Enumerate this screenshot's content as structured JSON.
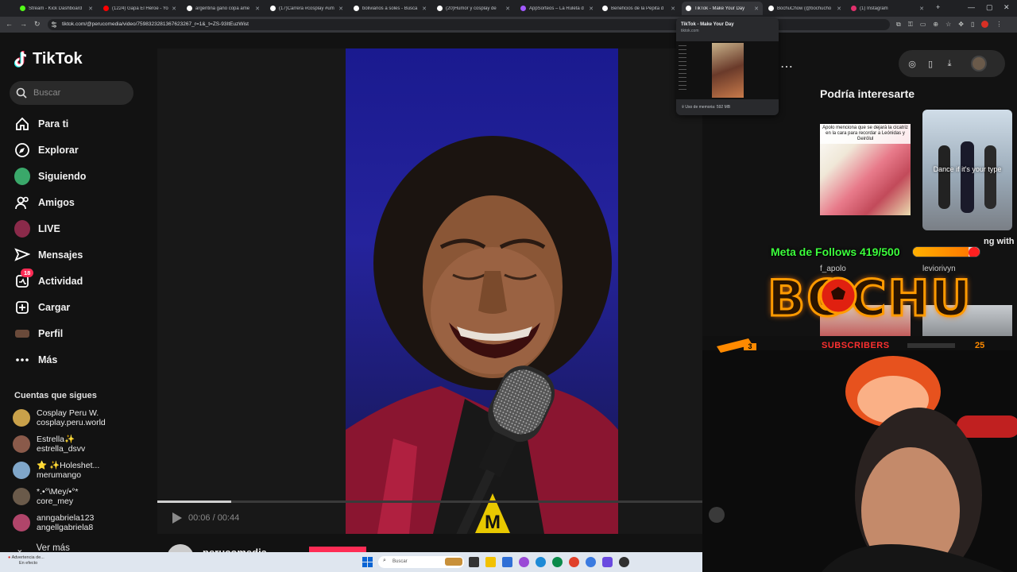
{
  "browser": {
    "tabs": [
      {
        "title": "Stream - Kick Dashboard",
        "color": "#53fc18"
      },
      {
        "title": "(1224) Gapa El Héroe - Yo",
        "color": "#ff0000"
      },
      {
        "title": "argentina gano copa ame",
        "color": "#ffffff"
      },
      {
        "title": "(17)Carrera #cosplay #um",
        "color": "#ffffff"
      },
      {
        "title": "bolivianos a soles - Busca",
        "color": "#ffffff"
      },
      {
        "title": "(20)Humor y cosplay de",
        "color": "#ffffff"
      },
      {
        "title": "AppSorteos – La Ruleta d",
        "color": "#a259ff"
      },
      {
        "title": "Beneficios de la Pepita d",
        "color": "#ffffff"
      },
      {
        "title": "TikTok - Make Your Day",
        "color": "#ffffff"
      },
      {
        "title": "BochuChow (@bochucho",
        "color": "#ffffff"
      },
      {
        "title": "(1) Instagram",
        "color": "#e1306c"
      }
    ],
    "new_tab": "+",
    "win_min": "—",
    "win_max": "▢",
    "win_close": "✕",
    "url": "tiktok.com/@perucomedia/video/7598323281367623267_r=1&_t=ZS-93ItEuzWist",
    "hover_card": {
      "title": "TikTok - Make Your Day",
      "domain": "tiktok.com",
      "memory": "Uso de memoria: 592 MB"
    }
  },
  "sidebar": {
    "logo": "TikTok",
    "search_placeholder": "Buscar",
    "nav": [
      {
        "label": "Para ti",
        "icon": "home-icon"
      },
      {
        "label": "Explorar",
        "icon": "compass-icon"
      },
      {
        "label": "Siguiendo",
        "icon": "following-avatar"
      },
      {
        "label": "Amigos",
        "icon": "friends-icon"
      },
      {
        "label": "LIVE",
        "icon": "live-avatar"
      },
      {
        "label": "Mensajes",
        "icon": "messages-icon"
      },
      {
        "label": "Actividad",
        "icon": "activity-icon",
        "badge": "18"
      },
      {
        "label": "Cargar",
        "icon": "upload-icon"
      },
      {
        "label": "Perfil",
        "icon": "profile-avatar"
      },
      {
        "label": "Más",
        "icon": "more-icon"
      }
    ],
    "following_heading": "Cuentas que sigues",
    "following": [
      {
        "name": "Cosplay Peru W.",
        "handle": "cosplay.peru.world",
        "color": "#c9a14a"
      },
      {
        "name": "Estrella✨",
        "handle": "estrella_dsvv",
        "color": "#8a5a4a"
      },
      {
        "name": "⭐ ✨Holeshet...",
        "handle": "merumango",
        "color": "#7fa6c9"
      },
      {
        "name": "*.•°\\Mey/•°*",
        "handle": "core_mey",
        "color": "#6a5a4a"
      },
      {
        "name": "anngabriela123",
        "handle": "angellgabriela8",
        "color": "#b0456a"
      }
    ],
    "see_more": "Ver más"
  },
  "video": {
    "time": "00:06 / 00:44",
    "progress": 0.136,
    "author": "perucomedia"
  },
  "recommend": {
    "heading": "Podría interesarte",
    "items": [
      {
        "caption": "Apolo menciona que se dejará la cicatriz en la cara para recordar a Leónidas y Geirölul",
        "user": "f_apolo"
      },
      {
        "caption": "Dance if it's your type",
        "user": "leviorivyn"
      }
    ],
    "partial_title_right": "ng with"
  },
  "overlay": {
    "follows_goal": "Meta de Follows 419/500",
    "follows_fraction": 0.838,
    "brand": "BOCHU",
    "subscribers_label": "SUBSCRIBERS",
    "subscribers_count": "25",
    "sub_badge": "3"
  },
  "taskbar": {
    "notification_line1": "Advertencia de...",
    "notification_line2": "En efecto",
    "search": "Buscar"
  }
}
